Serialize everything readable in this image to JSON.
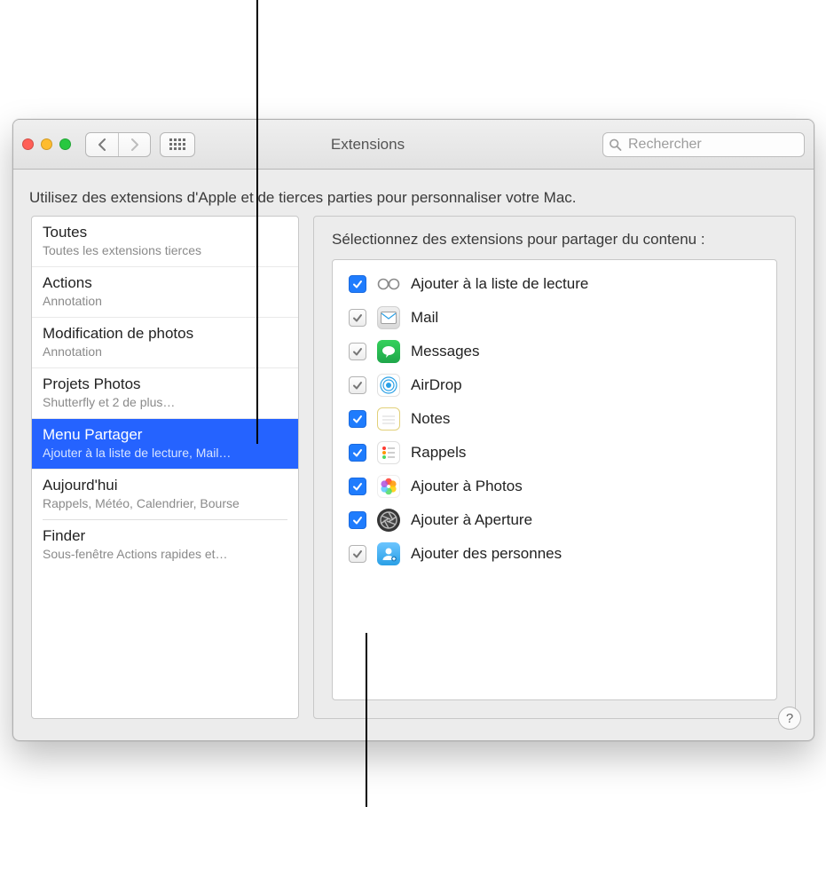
{
  "window": {
    "title": "Extensions"
  },
  "search": {
    "placeholder": "Rechercher"
  },
  "subtitle": "Utilisez des extensions d'Apple et de tierces parties pour personnaliser votre Mac.",
  "sidebar": {
    "items": [
      {
        "title": "Toutes",
        "subtitle": "Toutes les extensions tierces",
        "selected": false
      },
      {
        "title": "Actions",
        "subtitle": "Annotation",
        "selected": false
      },
      {
        "title": "Modification de photos",
        "subtitle": "Annotation",
        "selected": false
      },
      {
        "title": "Projets Photos",
        "subtitle": "Shutterfly et 2 de plus…",
        "selected": false
      },
      {
        "title": "Menu Partager",
        "subtitle": "Ajouter à la liste de lecture, Mail…",
        "selected": true
      },
      {
        "title": "Aujourd'hui",
        "subtitle": "Rappels, Météo, Calendrier, Bourse",
        "selected": false
      },
      {
        "title": "Finder",
        "subtitle": "Sous-fenêtre Actions rapides et…",
        "selected": false
      }
    ]
  },
  "panel": {
    "heading": "Sélectionnez des extensions pour partager du contenu :"
  },
  "extensions": [
    {
      "name": "Ajouter à la liste de lecture",
      "checked": true,
      "locked": false,
      "icon": "reading-list"
    },
    {
      "name": "Mail",
      "checked": true,
      "locked": true,
      "icon": "mail"
    },
    {
      "name": "Messages",
      "checked": true,
      "locked": true,
      "icon": "messages"
    },
    {
      "name": "AirDrop",
      "checked": true,
      "locked": true,
      "icon": "airdrop"
    },
    {
      "name": "Notes",
      "checked": true,
      "locked": false,
      "icon": "notes"
    },
    {
      "name": "Rappels",
      "checked": true,
      "locked": false,
      "icon": "reminders"
    },
    {
      "name": "Ajouter à Photos",
      "checked": true,
      "locked": false,
      "icon": "photos"
    },
    {
      "name": "Ajouter à Aperture",
      "checked": true,
      "locked": false,
      "icon": "aperture"
    },
    {
      "name": "Ajouter des personnes",
      "checked": true,
      "locked": true,
      "icon": "people"
    }
  ]
}
